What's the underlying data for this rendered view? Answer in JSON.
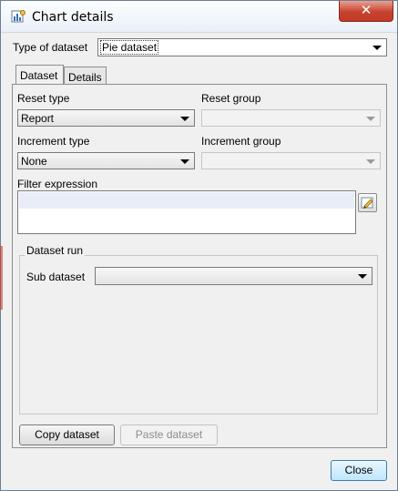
{
  "window": {
    "title": "Chart details",
    "close_glyph": "✕"
  },
  "dataset_type": {
    "label": "Type of dataset",
    "value": "Pie dataset"
  },
  "tabs": [
    {
      "label": "Dataset",
      "active": true
    },
    {
      "label": "Details",
      "active": false
    }
  ],
  "dataset": {
    "reset_type": {
      "label": "Reset type",
      "value": "Report"
    },
    "reset_group": {
      "label": "Reset group",
      "value": ""
    },
    "increment_type": {
      "label": "Increment type",
      "value": "None"
    },
    "increment_group": {
      "label": "Increment group",
      "value": ""
    },
    "filter_expression": {
      "label": "Filter expression",
      "value": ""
    },
    "dataset_run": {
      "title": "Dataset run",
      "sub_dataset_label": "Sub dataset",
      "sub_dataset_value": ""
    }
  },
  "buttons": {
    "copy": "Copy dataset",
    "paste": "Paste dataset",
    "close": "Close"
  },
  "icons": {
    "app": "chart-app-icon",
    "edit": "edit-expression-icon"
  },
  "colors": {
    "close_button": "#c7422e",
    "focus_border": "#3c7fb1"
  }
}
